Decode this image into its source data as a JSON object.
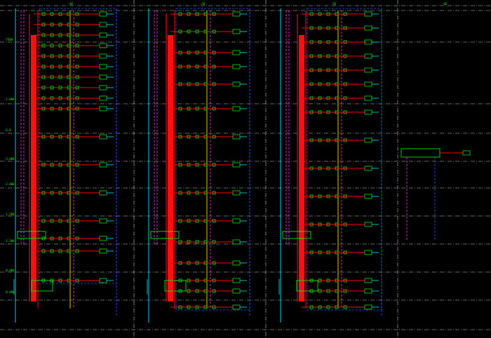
{
  "drawing": {
    "column_headers": [
      "-6E",
      "-5E",
      "-5E",
      "-6E"
    ],
    "level_labels": [
      "-7500",
      "-1.000",
      "-6.0",
      "-3.000",
      "-2.800",
      "-1.500",
      "-1.500",
      "-0.000",
      "-0.000"
    ],
    "colors": {
      "background": "#000000",
      "grid": "#c8c8c8",
      "feeder": "#ff0000",
      "riser_main": "#ff1010",
      "boundary": "#1e5aff",
      "green": "#00ff00",
      "yellow": "#ffd700",
      "magenta": "#ff33ff",
      "cyan": "#00e5ff",
      "white": "#ffffff"
    }
  }
}
